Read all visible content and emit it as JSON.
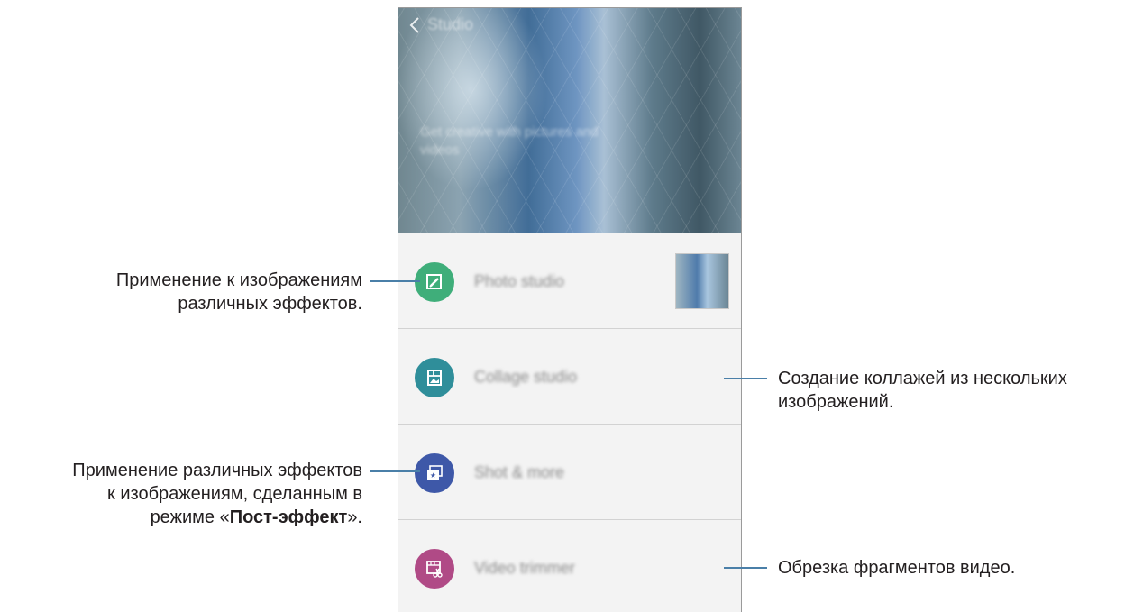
{
  "screen": {
    "title": "Studio",
    "tagline": "Get creative with pictures and videos",
    "items": [
      {
        "label": "Photo studio",
        "icon": "photo-edit-icon",
        "color": "#3fae7a"
      },
      {
        "label": "Collage studio",
        "icon": "collage-icon",
        "color": "#2f8e9a"
      },
      {
        "label": "Shot & more",
        "icon": "shot-more-icon",
        "color": "#3e58a8"
      },
      {
        "label": "Video trimmer",
        "icon": "video-trim-icon",
        "color": "#b04a86"
      }
    ]
  },
  "annotations": {
    "photo_studio": {
      "line1": "Применение к изображениям",
      "line2": "различных эффектов."
    },
    "collage_studio": {
      "line1": "Создание коллажей из нескольких",
      "line2": "изображений."
    },
    "shot_more": {
      "line1": "Применение различных эффектов",
      "line2": "к изображениям, сделанным в",
      "line3_prefix": "режиме «",
      "line3_bold": "Пост-эффект",
      "line3_suffix": "»."
    },
    "video_trimmer": {
      "line1": "Обрезка фрагментов видео."
    }
  },
  "colors": {
    "leader": "#4a7fa8",
    "text": "#231f20"
  }
}
